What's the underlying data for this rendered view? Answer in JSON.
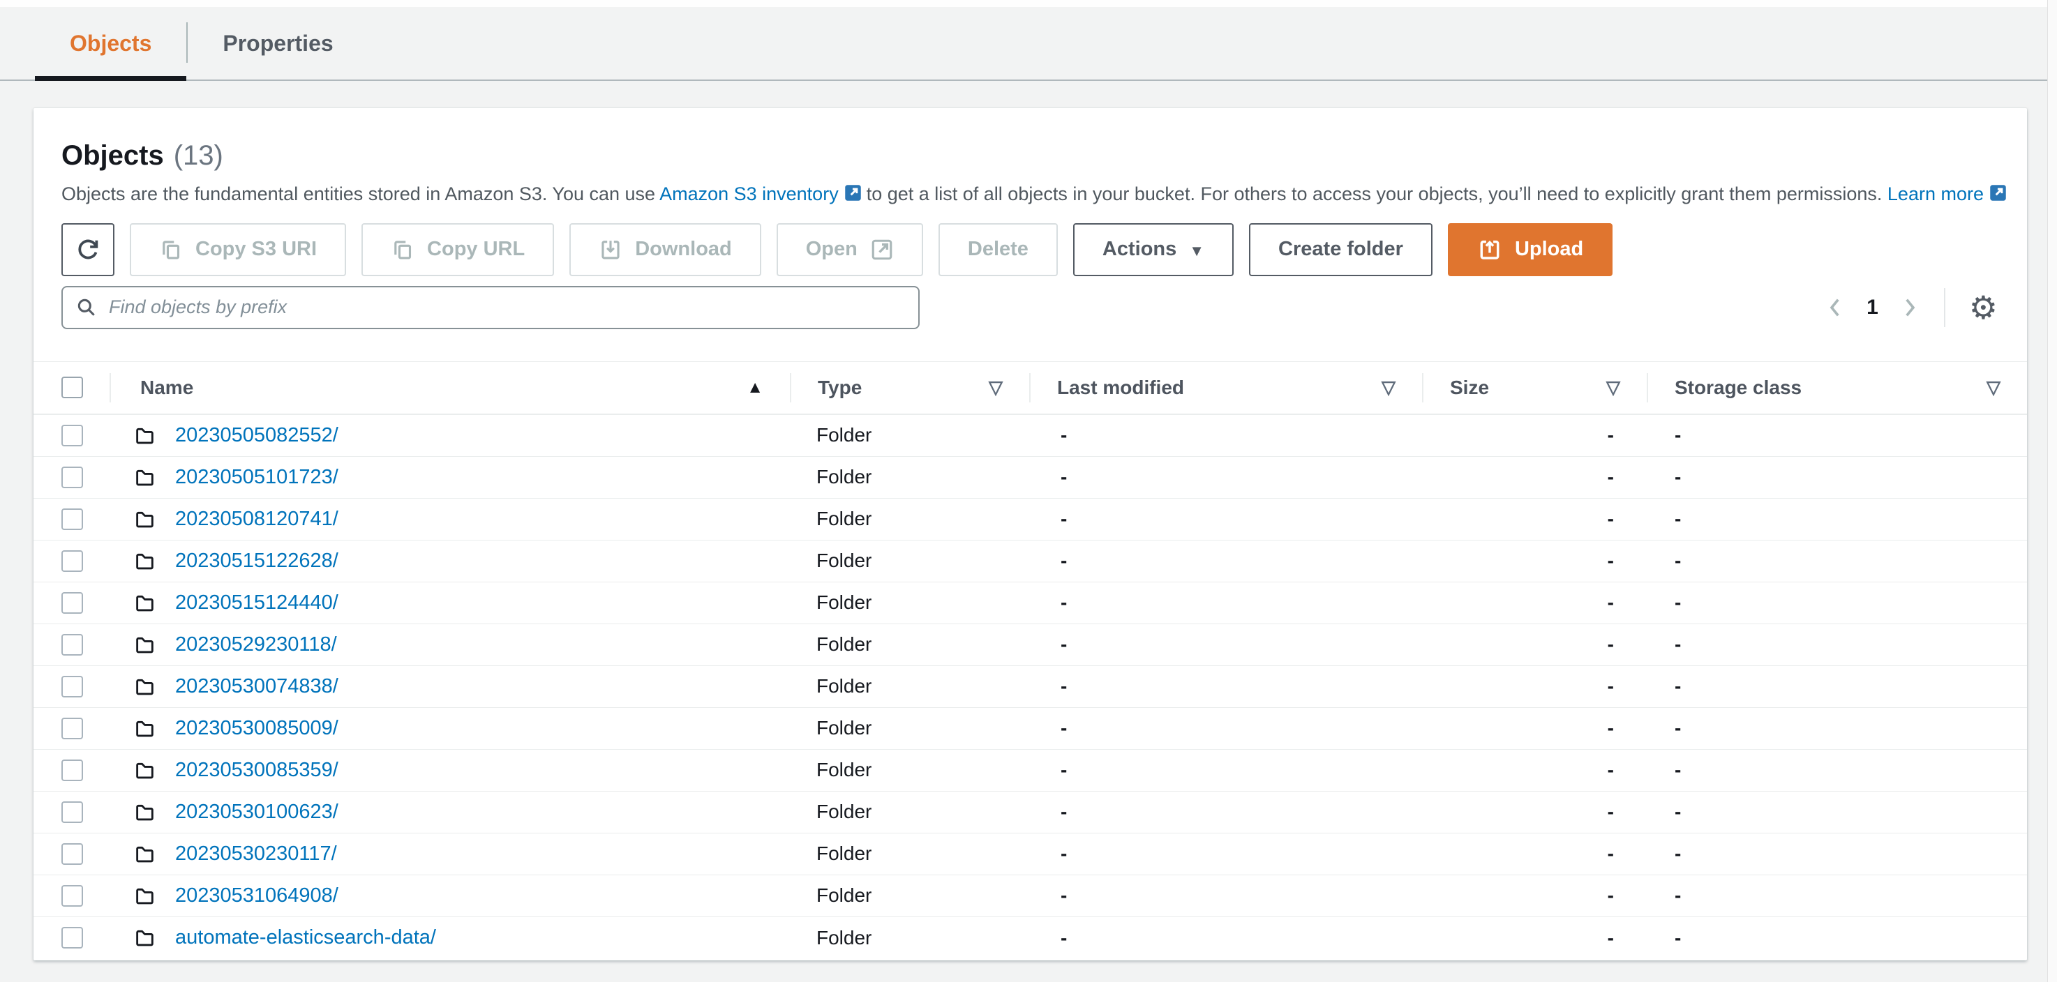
{
  "tabs": [
    {
      "label": "Objects",
      "active": true
    },
    {
      "label": "Properties",
      "active": false
    }
  ],
  "panel": {
    "title": "Objects",
    "count": "(13)",
    "description": {
      "text_before_link1": "Objects are the fundamental entities stored in Amazon S3. You can use",
      "link1": "Amazon S3 inventory",
      "text_middle": "to get a list of all objects in your bucket. For others to access your objects, you’ll need to explicitly grant them permissions.",
      "link2": "Learn more"
    },
    "toolbar": {
      "copy_s3_uri": "Copy S3 URI",
      "copy_url": "Copy URL",
      "download": "Download",
      "open": "Open",
      "delete": "Delete",
      "actions": "Actions",
      "create_folder": "Create folder",
      "upload": "Upload"
    },
    "search": {
      "placeholder": "Find objects by prefix"
    },
    "pagination": {
      "current_page": "1"
    },
    "table": {
      "columns": [
        {
          "label": "Name"
        },
        {
          "label": "Type"
        },
        {
          "label": "Last modified"
        },
        {
          "label": "Size"
        },
        {
          "label": "Storage class"
        }
      ],
      "rows": [
        {
          "name": "20230505082552/",
          "type": "Folder",
          "last_modified": "-",
          "size": "-",
          "storage_class": "-"
        },
        {
          "name": "20230505101723/",
          "type": "Folder",
          "last_modified": "-",
          "size": "-",
          "storage_class": "-"
        },
        {
          "name": "20230508120741/",
          "type": "Folder",
          "last_modified": "-",
          "size": "-",
          "storage_class": "-"
        },
        {
          "name": "20230515122628/",
          "type": "Folder",
          "last_modified": "-",
          "size": "-",
          "storage_class": "-"
        },
        {
          "name": "20230515124440/",
          "type": "Folder",
          "last_modified": "-",
          "size": "-",
          "storage_class": "-"
        },
        {
          "name": "20230529230118/",
          "type": "Folder",
          "last_modified": "-",
          "size": "-",
          "storage_class": "-"
        },
        {
          "name": "20230530074838/",
          "type": "Folder",
          "last_modified": "-",
          "size": "-",
          "storage_class": "-"
        },
        {
          "name": "20230530085009/",
          "type": "Folder",
          "last_modified": "-",
          "size": "-",
          "storage_class": "-"
        },
        {
          "name": "20230530085359/",
          "type": "Folder",
          "last_modified": "-",
          "size": "-",
          "storage_class": "-"
        },
        {
          "name": "20230530100623/",
          "type": "Folder",
          "last_modified": "-",
          "size": "-",
          "storage_class": "-"
        },
        {
          "name": "20230530230117/",
          "type": "Folder",
          "last_modified": "-",
          "size": "-",
          "storage_class": "-"
        },
        {
          "name": "20230531064908/",
          "type": "Folder",
          "last_modified": "-",
          "size": "-",
          "storage_class": "-"
        },
        {
          "name": "automate-elasticsearch-data/",
          "type": "Folder",
          "last_modified": "-",
          "size": "-",
          "storage_class": "-"
        }
      ]
    }
  },
  "icons": {
    "sort_ascending": "▲",
    "filter": "▽",
    "caret_down": "▼",
    "gear": "⚙"
  },
  "colors": {
    "accent_orange": "#e0752f",
    "link_blue": "#0073bb",
    "text_dark": "#16191f",
    "text_secondary": "#545b64",
    "disabled_gray": "#aab7b8",
    "border_light": "#eaeded",
    "page_background": "#f2f3f3",
    "active_tab_underline": "#16191f"
  }
}
